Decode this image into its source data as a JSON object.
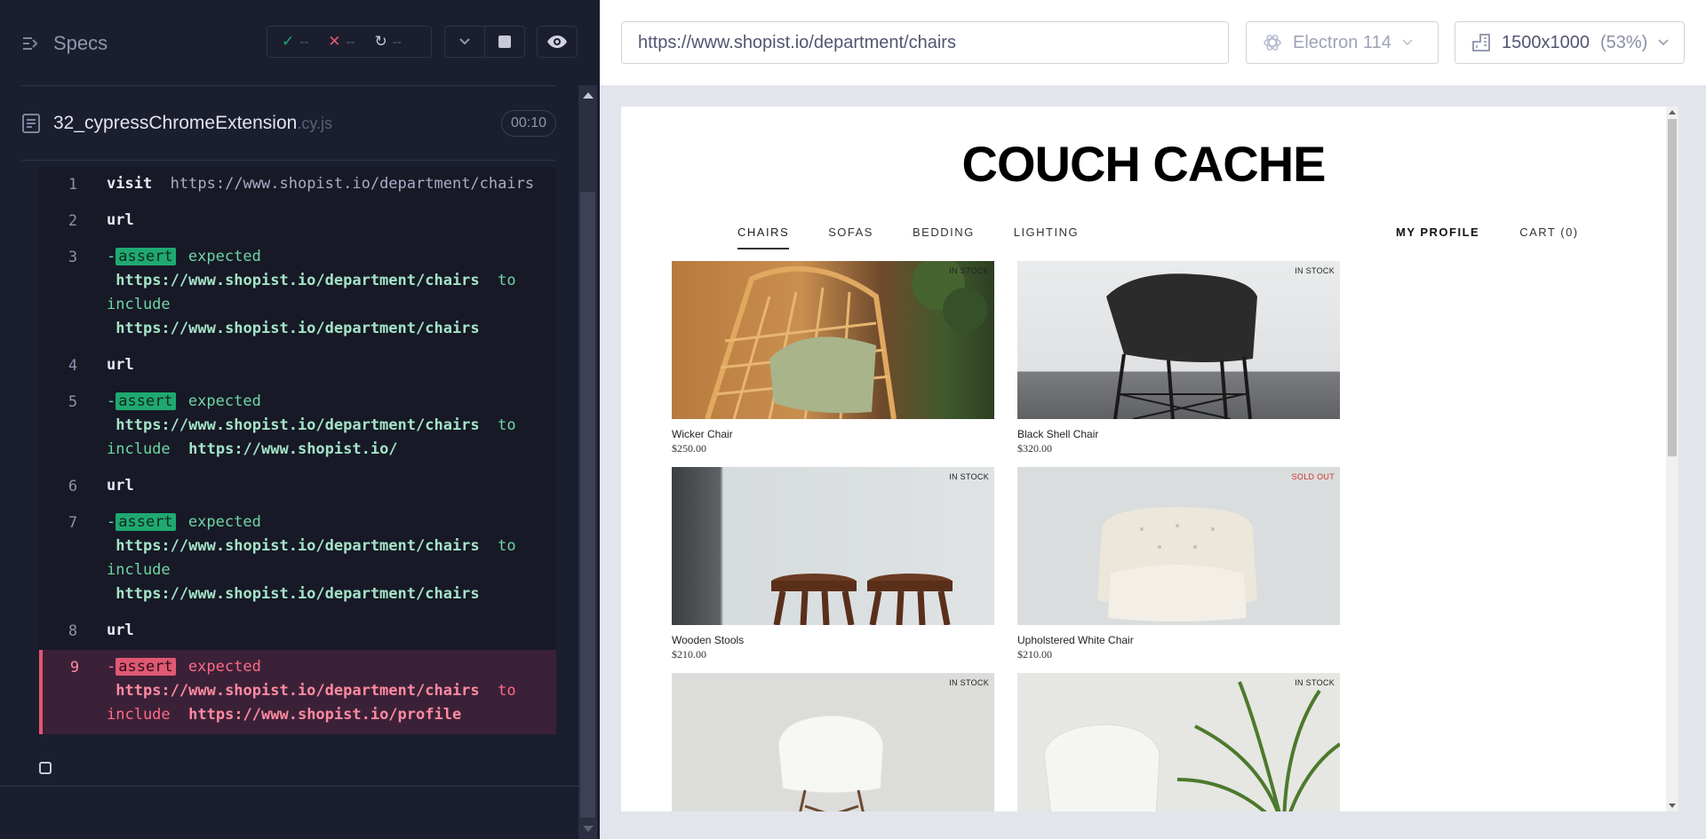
{
  "reporter": {
    "specs_label": "Specs",
    "stats": {
      "passed": "--",
      "failed": "--",
      "pending": "--"
    },
    "spec_file": {
      "name": "32_cypressChromeExtension",
      "ext": ".cy.js",
      "duration": "00:10"
    },
    "commands": [
      {
        "num": "1",
        "name": "visit",
        "message": "https://www.shopist.io/department/chairs",
        "state": "pass"
      },
      {
        "num": "2",
        "name": "url",
        "state": "pass"
      },
      {
        "num": "3",
        "name": "assert",
        "prefix": "-",
        "expected_word": "expected",
        "actual": "https://www.shopist.io/department/chairs",
        "to_word": "to",
        "include_word": "include",
        "target": "https://www.shopist.io/department/chairs",
        "state": "pass"
      },
      {
        "num": "4",
        "name": "url",
        "state": "pass"
      },
      {
        "num": "5",
        "name": "assert",
        "prefix": "-",
        "expected_word": "expected",
        "actual": "https://www.shopist.io/department/chairs",
        "to_word": "to",
        "include_word": "include",
        "target": "https://www.shopist.io/",
        "state": "pass"
      },
      {
        "num": "6",
        "name": "url",
        "state": "pass"
      },
      {
        "num": "7",
        "name": "assert",
        "prefix": "-",
        "expected_word": "expected",
        "actual": "https://www.shopist.io/department/chairs",
        "to_word": "to",
        "include_word": "include",
        "target": "https://www.shopist.io/department/chairs",
        "state": "pass"
      },
      {
        "num": "8",
        "name": "url",
        "state": "pass"
      },
      {
        "num": "9",
        "name": "assert",
        "prefix": "-",
        "expected_word": "expected",
        "actual": "https://www.shopist.io/department/chairs",
        "to_word": "to",
        "include_word": "include",
        "target": "https://www.shopist.io/profile",
        "state": "failed"
      }
    ]
  },
  "toolbar": {
    "url": "https://www.shopist.io/department/chairs",
    "browser": "Electron 114",
    "viewport": "1500x1000",
    "scale": "(53%)"
  },
  "aut": {
    "brand": "COUCH CACHE",
    "nav": [
      "CHAIRS",
      "SOFAS",
      "BEDDING",
      "LIGHTING"
    ],
    "nav_right": {
      "profile": "MY PROFILE",
      "cart": "CART (0)"
    },
    "products": [
      {
        "name": "Wicker Chair",
        "price": "$250.00",
        "stock": "IN STOCK"
      },
      {
        "name": "Black Shell Chair",
        "price": "$320.00",
        "stock": "IN STOCK"
      },
      {
        "name": "Wooden Stools",
        "price": "$210.00",
        "stock": "IN STOCK"
      },
      {
        "name": "Upholstered White Chair",
        "price": "$210.00",
        "stock": "SOLD OUT"
      },
      {
        "name": "",
        "price": "",
        "stock": "IN STOCK"
      },
      {
        "name": "",
        "price": "",
        "stock": "IN STOCK"
      }
    ]
  },
  "colors": {
    "pass": "#1fa971",
    "fail": "#e05873",
    "sold_out": "#d0312d"
  }
}
